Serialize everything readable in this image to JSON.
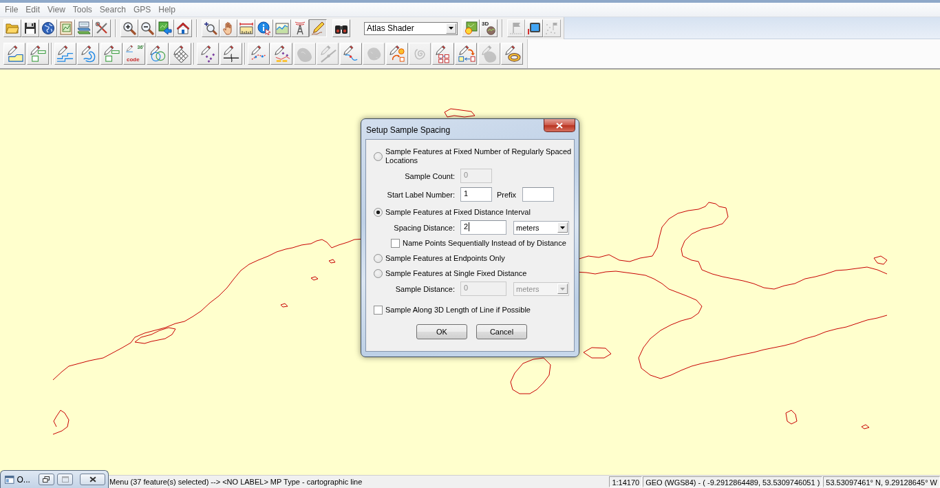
{
  "menu_bar": {
    "items": [
      "File",
      "Edit",
      "View",
      "Tools",
      "Search",
      "GPS",
      "Help"
    ]
  },
  "toolbar_1": {
    "groups": [
      {
        "items": [
          {
            "kind": "folder",
            "selected": false,
            "disabled": false
          },
          {
            "kind": "floppy",
            "selected": false,
            "disabled": false
          },
          {
            "kind": "globe",
            "selected": false,
            "disabled": false
          },
          {
            "kind": "mapsheet",
            "selected": false,
            "disabled": false
          },
          {
            "kind": "mapstack",
            "selected": false,
            "disabled": false
          },
          {
            "kind": "tools",
            "selected": false,
            "disabled": false
          }
        ]
      },
      {
        "items": [
          {
            "kind": "zoomin",
            "selected": false,
            "disabled": false
          },
          {
            "kind": "zoomout",
            "selected": false,
            "disabled": false
          },
          {
            "kind": "maparrow",
            "selected": false,
            "disabled": false
          },
          {
            "kind": "house",
            "selected": false,
            "disabled": false
          }
        ]
      },
      {
        "items": [
          {
            "kind": "zoomcursor",
            "selected": false,
            "disabled": false
          },
          {
            "kind": "hand",
            "selected": false,
            "disabled": false
          },
          {
            "kind": "ruler",
            "selected": false,
            "disabled": false
          },
          {
            "kind": "infocursor",
            "selected": false,
            "disabled": false
          },
          {
            "kind": "chart",
            "selected": false,
            "disabled": false
          },
          {
            "kind": "tower",
            "selected": false,
            "disabled": false
          },
          {
            "kind": "pencil",
            "selected": true,
            "disabled": false
          },
          {
            "kind": "binoculars",
            "selected": false,
            "disabled": false
          },
          {
            "kind": "select",
            "value": "Atlas Shader",
            "disabled": false
          },
          {
            "kind": "sunmap",
            "selected": false,
            "disabled": false
          },
          {
            "kind": "terrain",
            "labels": [
              "3D"
            ],
            "selected": false,
            "disabled": false
          }
        ]
      },
      {
        "items": [
          {
            "kind": "flag",
            "selected": false,
            "disabled": true
          },
          {
            "kind": "monitor",
            "selected": false,
            "disabled": false
          },
          {
            "kind": "sparkleflag",
            "selected": false,
            "disabled": true
          }
        ]
      }
    ]
  },
  "toolbar_2": {
    "groups": [
      {
        "items": [
          {
            "kind": "area",
            "selected": false,
            "disabled": false
          },
          {
            "kind": "boxes",
            "selected": false,
            "disabled": false
          }
        ]
      },
      {
        "items": [
          {
            "kind": "steps",
            "selected": false,
            "disabled": false
          },
          {
            "kind": "squiggle",
            "selected": false,
            "disabled": false
          },
          {
            "kind": "boxes",
            "selected": false,
            "disabled": false
          },
          {
            "kind": "code",
            "labels": [
              "36'",
              "code"
            ],
            "selected": false,
            "disabled": false
          },
          {
            "kind": "circles",
            "selected": false,
            "disabled": false
          },
          {
            "kind": "grid",
            "selected": false,
            "disabled": false
          }
        ]
      },
      {
        "items": [
          {
            "kind": "points",
            "selected": false,
            "disabled": false
          },
          {
            "kind": "crossline",
            "selected": false,
            "disabled": false
          }
        ]
      },
      {
        "items": [
          {
            "kind": "dotted",
            "selected": false,
            "disabled": false
          },
          {
            "kind": "network",
            "selected": false,
            "disabled": false
          },
          {
            "kind": "blob",
            "selected": false,
            "disabled": true
          },
          {
            "kind": "diagonal",
            "selected": false,
            "disabled": true
          },
          {
            "kind": "curve",
            "selected": false,
            "disabled": false
          },
          {
            "kind": "blob2",
            "selected": false,
            "disabled": true
          },
          {
            "kind": "shapes",
            "selected": false,
            "disabled": false
          },
          {
            "kind": "spiral",
            "selected": false,
            "disabled": true
          },
          {
            "kind": "squares",
            "selected": false,
            "disabled": false
          },
          {
            "kind": "swap",
            "selected": false,
            "disabled": false
          },
          {
            "kind": "blob3",
            "selected": false,
            "disabled": true
          },
          {
            "kind": "ring",
            "selected": false,
            "disabled": false
          }
        ]
      }
    ]
  },
  "dialog": {
    "title": "Setup Sample Spacing",
    "sections": [
      {
        "kind": "radio",
        "label": "Sample Features at Fixed Number of Regularly Spaced Locations",
        "selected": false,
        "rows": [
          [
            {
              "kind": "label",
              "text": "Sample Count:"
            },
            {
              "kind": "input",
              "value": "0",
              "disabled": true,
              "focused": false
            }
          ],
          [
            {
              "kind": "label",
              "text": "Start Label Number:"
            },
            {
              "kind": "input",
              "value": "1",
              "disabled": false,
              "focused": false
            },
            {
              "kind": "label",
              "text": "Prefix"
            },
            {
              "kind": "input",
              "disabled": false,
              "focused": false
            }
          ]
        ]
      },
      {
        "kind": "radio",
        "label": "Sample Features at Fixed Distance Interval",
        "selected": true,
        "rows": [
          [
            {
              "kind": "label",
              "text": "Spacing Distance:"
            },
            {
              "kind": "input",
              "value": "2",
              "disabled": false,
              "focused": true
            },
            {
              "kind": "select",
              "value": "meters",
              "disabled": false
            }
          ],
          [
            {
              "kind": "checkbox",
              "label": "Name Points Sequentially Instead of by Distance",
              "checked": false
            }
          ]
        ]
      },
      {
        "kind": "radio",
        "label": "Sample Features at Endpoints Only",
        "selected": false
      },
      {
        "kind": "radio",
        "label": "Sample Features at Single Fixed Distance",
        "selected": false,
        "rows": [
          [
            {
              "kind": "label",
              "text": "Sample Distance:"
            },
            {
              "kind": "input",
              "value": "0",
              "disabled": true,
              "focused": false
            },
            {
              "kind": "select",
              "value": "meters",
              "disabled": true
            }
          ]
        ]
      },
      {
        "kind": "checkbox",
        "label": "Sample Along 3D Length of Line if Possible",
        "checked": false
      }
    ],
    "buttons": [
      "OK",
      "Cancel"
    ]
  },
  "minimized_window": {
    "title": "O...",
    "buttons": [
      {
        "kind": "restore",
        "disabled": false
      },
      {
        "kind": "maximize",
        "disabled": true
      },
      {
        "kind": "close",
        "disabled": false
      }
    ]
  },
  "status_bar": {
    "message": "Menu (37 feature(s) selected) --> <NO LABEL> MP Type - cartographic line",
    "panels": [
      "1:14170",
      "GEO (WGS84) - ( -9.2912864489, 53.5309746051 )",
      "53.53097461° N, 9.29128645° W"
    ]
  }
}
